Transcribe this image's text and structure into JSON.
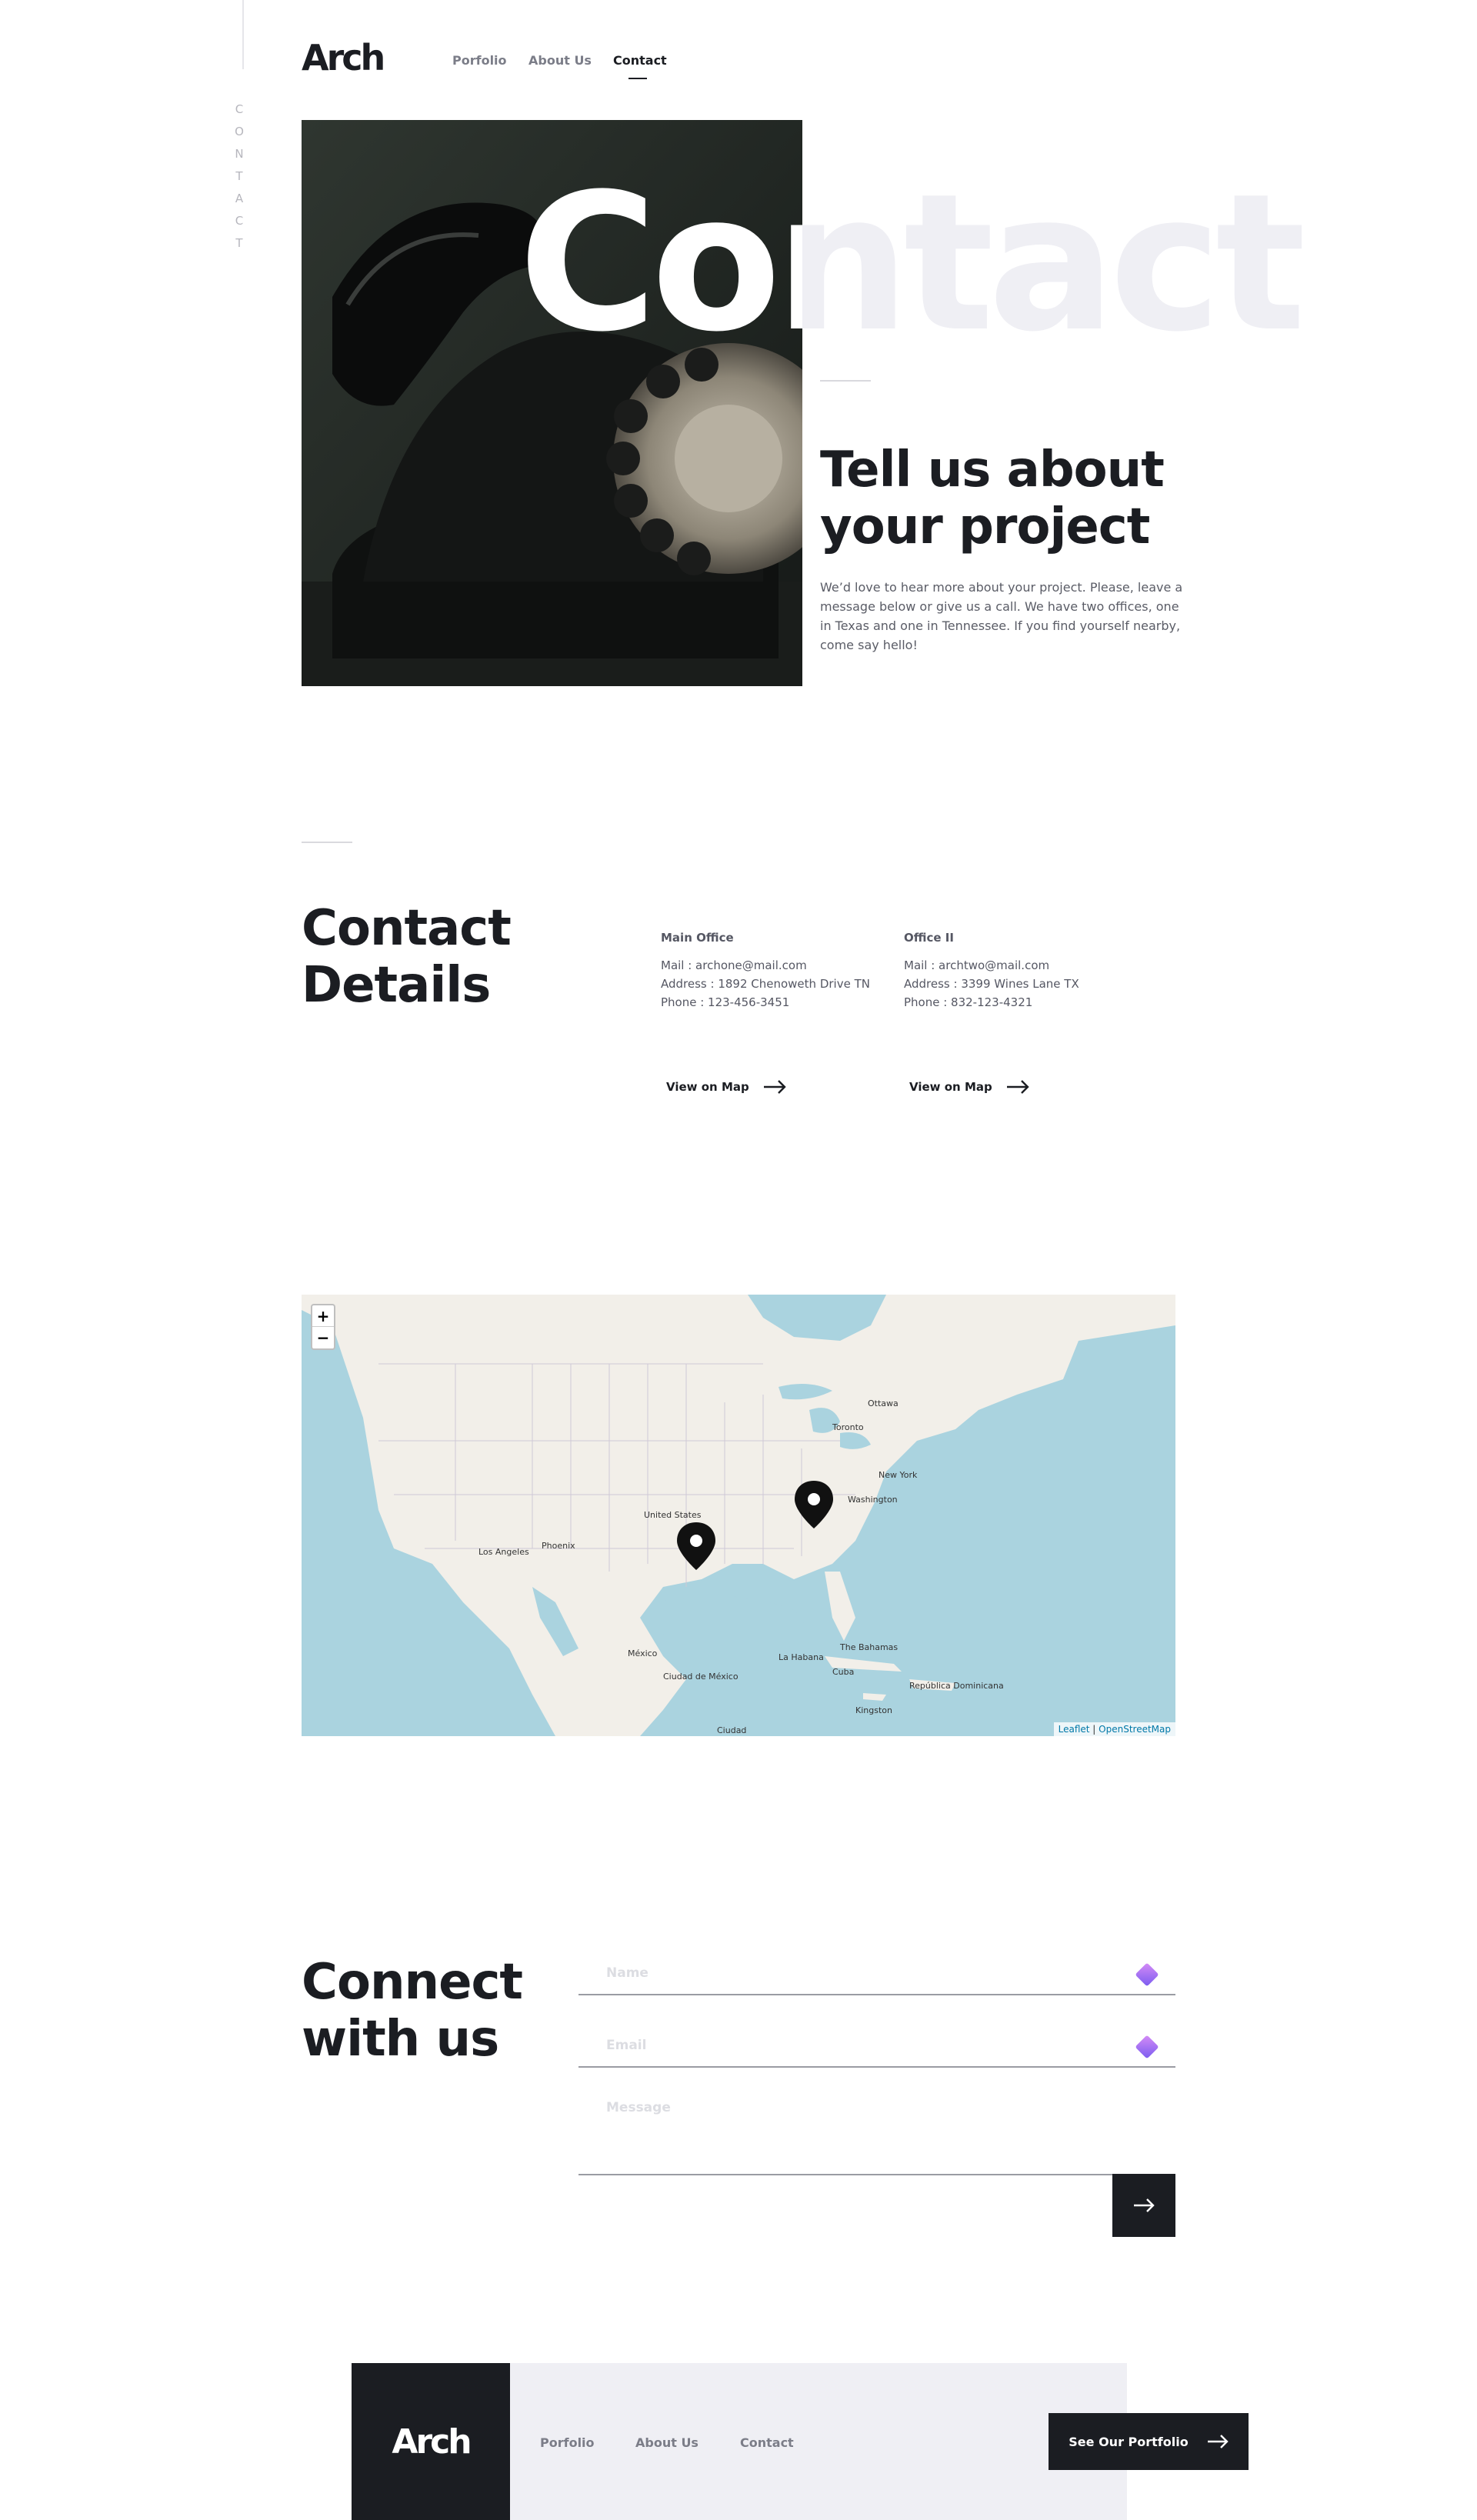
{
  "side": {
    "label": "CONTACT"
  },
  "header": {
    "logo": "Arch",
    "nav": [
      {
        "label": "Porfolio"
      },
      {
        "label": "About Us"
      },
      {
        "label": "Contact"
      }
    ]
  },
  "hero": {
    "big_word": "Contact",
    "heading": "Tell us about your project",
    "body": "We’d love to hear more about your project. Please, leave a message below or give us a call. We have two offices, one in Texas and one in Tennessee. If you find yourself nearby, come say hello!"
  },
  "contact_details": {
    "heading": "Contact Details",
    "offices": [
      {
        "title": "Main Office",
        "mail": "Mail : archone@mail.com",
        "address": "Address : 1892 Chenoweth Drive TN",
        "phone": "Phone : 123-456-3451",
        "map_link": "View on Map"
      },
      {
        "title": "Office II",
        "mail": "Mail : archtwo@mail.com",
        "address": "Address : 3399 Wines Lane TX",
        "phone": "Phone : 832-123-4321",
        "map_link": "View on Map"
      }
    ]
  },
  "map": {
    "zoom_in": "+",
    "zoom_out": "−",
    "attribution_leaflet": "Leaflet",
    "attribution_sep": " | ",
    "attribution_osm": "OpenStreetMap",
    "cities": [
      "Ottawa",
      "Toronto",
      "New York",
      "Washington",
      "United States",
      "Los Angeles",
      "Phoenix",
      "México",
      "Ciudad de México",
      "La Habana",
      "The Bahamas",
      "Cuba",
      "Kingston",
      "República Dominicana",
      "Ciudad"
    ]
  },
  "connect": {
    "heading": "Connect with us",
    "name_placeholder": "Name",
    "email_placeholder": "Email",
    "message_placeholder": "Message"
  },
  "footer": {
    "logo": "Arch",
    "nav": [
      {
        "label": "Porfolio"
      },
      {
        "label": "About Us"
      },
      {
        "label": "Contact"
      }
    ],
    "cta": "See Our Portfolio"
  }
}
